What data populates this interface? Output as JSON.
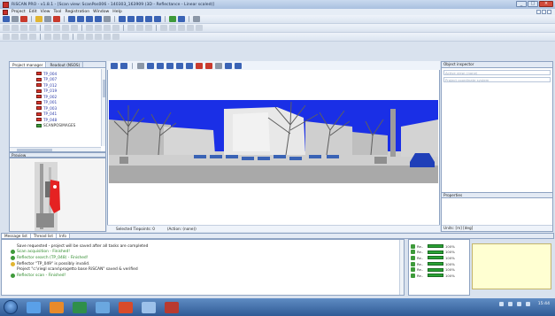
{
  "window": {
    "title": "RiSCAN PRO - v1.8.1 - [Scan view: ScanPos006 - 140303_163909 (3D - Reflectance - Linear scaled)]",
    "controls": [
      "_",
      "□",
      "×"
    ]
  },
  "menu": [
    "Project",
    "Edit",
    "View",
    "Tool",
    "Registration",
    "Window",
    "Help"
  ],
  "left_panel": {
    "tabs": [
      "Project manager",
      "Readout (NSOS)"
    ],
    "tree_items": [
      "TP_004",
      "TP_007",
      "TP_012",
      "TP_019",
      "TP_002",
      "TP_001",
      "TP_003",
      "TP_041",
      "TP_048"
    ],
    "tree_last": "SCANPOSIMAGES",
    "preview_label": "Preview"
  },
  "viewer": {
    "status_tiepoints": "Selected Tiepoints: 0",
    "status_action": "(Action: (none))"
  },
  "inspector": {
    "title": "Object inspector",
    "field1": "Active view: (none)",
    "field2": "Project coordinate system",
    "properties": "Properties",
    "units": "Units: [m] [deg]"
  },
  "message_tabs": [
    "Message list",
    "Thread list",
    "Info"
  ],
  "messages": [
    {
      "icon": "blank",
      "color": "black",
      "text": "Save requested - project will be saved after all tasks are completed"
    },
    {
      "icon": "check",
      "color": "green",
      "text": "Scan acquisition - Finished!"
    },
    {
      "icon": "check",
      "color": "green",
      "text": "Reflector search (TP_048) - Finished!"
    },
    {
      "icon": "warn",
      "color": "black",
      "text": "Reflector \"TP_049\" is possibly invalid."
    },
    {
      "icon": "blank",
      "color": "black",
      "text": "Project \"c:\\riegl scans\\progetto base RiSCAN\" saved & verified"
    },
    {
      "icon": "check",
      "color": "green",
      "text": "Reflector scan - Finished!"
    }
  ],
  "tasks": [
    {
      "name": "Re..",
      "pct": "100%"
    },
    {
      "name": "Re..",
      "pct": "100%"
    },
    {
      "name": "Re..",
      "pct": "100%"
    },
    {
      "name": "Re..",
      "pct": "100%"
    },
    {
      "name": "Re..",
      "pct": "100%"
    },
    {
      "name": "Re..",
      "pct": "100%"
    }
  ],
  "taskbar": {
    "clock": "15:44"
  },
  "colors": {
    "sky": "#1a2fe6",
    "accent": "#3a63b5",
    "progress": "#29a234"
  }
}
